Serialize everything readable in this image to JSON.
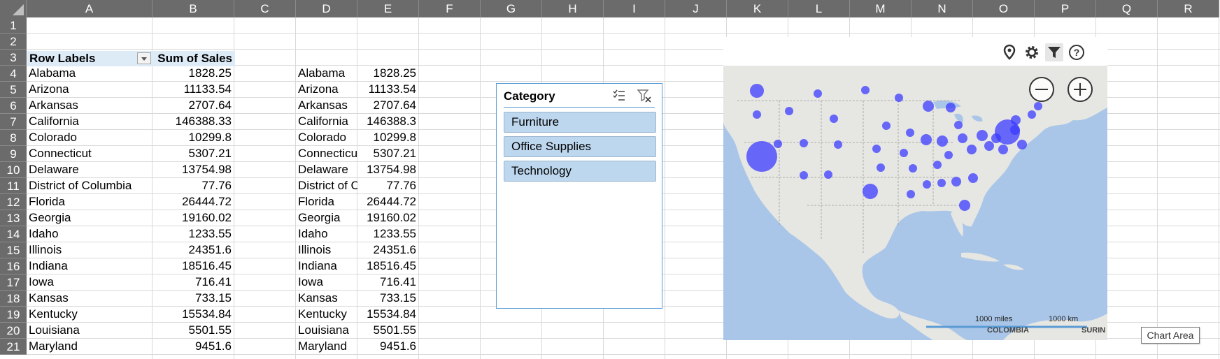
{
  "columns": [
    "A",
    "B",
    "C",
    "D",
    "E",
    "F",
    "G",
    "H",
    "I",
    "J",
    "K",
    "L",
    "M",
    "N",
    "O",
    "P",
    "Q",
    "R"
  ],
  "rows": [
    "1",
    "2",
    "3",
    "4",
    "5",
    "6",
    "7",
    "8",
    "9",
    "10",
    "11",
    "12",
    "13",
    "14",
    "15",
    "16",
    "17",
    "18",
    "19",
    "20",
    "21"
  ],
  "pivot": {
    "header_row_labels": "Row Labels",
    "header_sum": "Sum of Sales",
    "rows": [
      {
        "state": "Alabama",
        "sales": "1828.25"
      },
      {
        "state": "Arizona",
        "sales": "11133.54"
      },
      {
        "state": "Arkansas",
        "sales": "2707.64"
      },
      {
        "state": "California",
        "sales": "146388.33"
      },
      {
        "state": "Colorado",
        "sales": "10299.8"
      },
      {
        "state": "Connecticut",
        "sales": "5307.21"
      },
      {
        "state": "Delaware",
        "sales": "13754.98"
      },
      {
        "state": "District of Columbia",
        "sales": "77.76"
      },
      {
        "state": "Florida",
        "sales": "26444.72"
      },
      {
        "state": "Georgia",
        "sales": "19160.02"
      },
      {
        "state": "Idaho",
        "sales": "1233.55"
      },
      {
        "state": "Illinois",
        "sales": "24351.6"
      },
      {
        "state": "Indiana",
        "sales": "18516.45"
      },
      {
        "state": "Iowa",
        "sales": "716.41"
      },
      {
        "state": "Kansas",
        "sales": "733.15"
      },
      {
        "state": "Kentucky",
        "sales": "15534.84"
      },
      {
        "state": "Louisiana",
        "sales": "5501.55"
      },
      {
        "state": "Maryland",
        "sales": "9451.6"
      }
    ]
  },
  "copy": {
    "rows": [
      {
        "state": "Alabama",
        "sales": "1828.25"
      },
      {
        "state": "Arizona",
        "sales": "11133.54"
      },
      {
        "state": "Arkansas",
        "sales": "2707.64"
      },
      {
        "state": "California",
        "sales": "146388.3"
      },
      {
        "state": "Colorado",
        "sales": "10299.8"
      },
      {
        "state": "Connecticut",
        "sales": "5307.21"
      },
      {
        "state": "Delaware",
        "sales": "13754.98"
      },
      {
        "state": "District of Columbia",
        "sales": "77.76"
      },
      {
        "state": "Florida",
        "sales": "26444.72"
      },
      {
        "state": "Georgia",
        "sales": "19160.02"
      },
      {
        "state": "Idaho",
        "sales": "1233.55"
      },
      {
        "state": "Illinois",
        "sales": "24351.6"
      },
      {
        "state": "Indiana",
        "sales": "18516.45"
      },
      {
        "state": "Iowa",
        "sales": "716.41"
      },
      {
        "state": "Kansas",
        "sales": "733.15"
      },
      {
        "state": "Kentucky",
        "sales": "15534.84"
      },
      {
        "state": "Louisiana",
        "sales": "5501.55"
      },
      {
        "state": "Maryland",
        "sales": "9451.6"
      }
    ]
  },
  "slicer": {
    "title": "Category",
    "items": [
      "Furniture",
      "Office Supplies",
      "Technology"
    ],
    "icons": [
      "multi-select-icon",
      "clear-filter-icon"
    ]
  },
  "map": {
    "toolbar_icons": [
      "map-pin-icon",
      "gear-icon",
      "filter-icon",
      "help-icon"
    ],
    "zoom_out_icon": "minus-icon",
    "zoom_in_icon": "plus-icon",
    "scale_miles": "1000 miles",
    "scale_km": "1000 km",
    "labels": [
      "COLOMBIA",
      "SURIN"
    ],
    "bubble_color": "#3b3bff"
  },
  "tooltip": "Chart Area"
}
